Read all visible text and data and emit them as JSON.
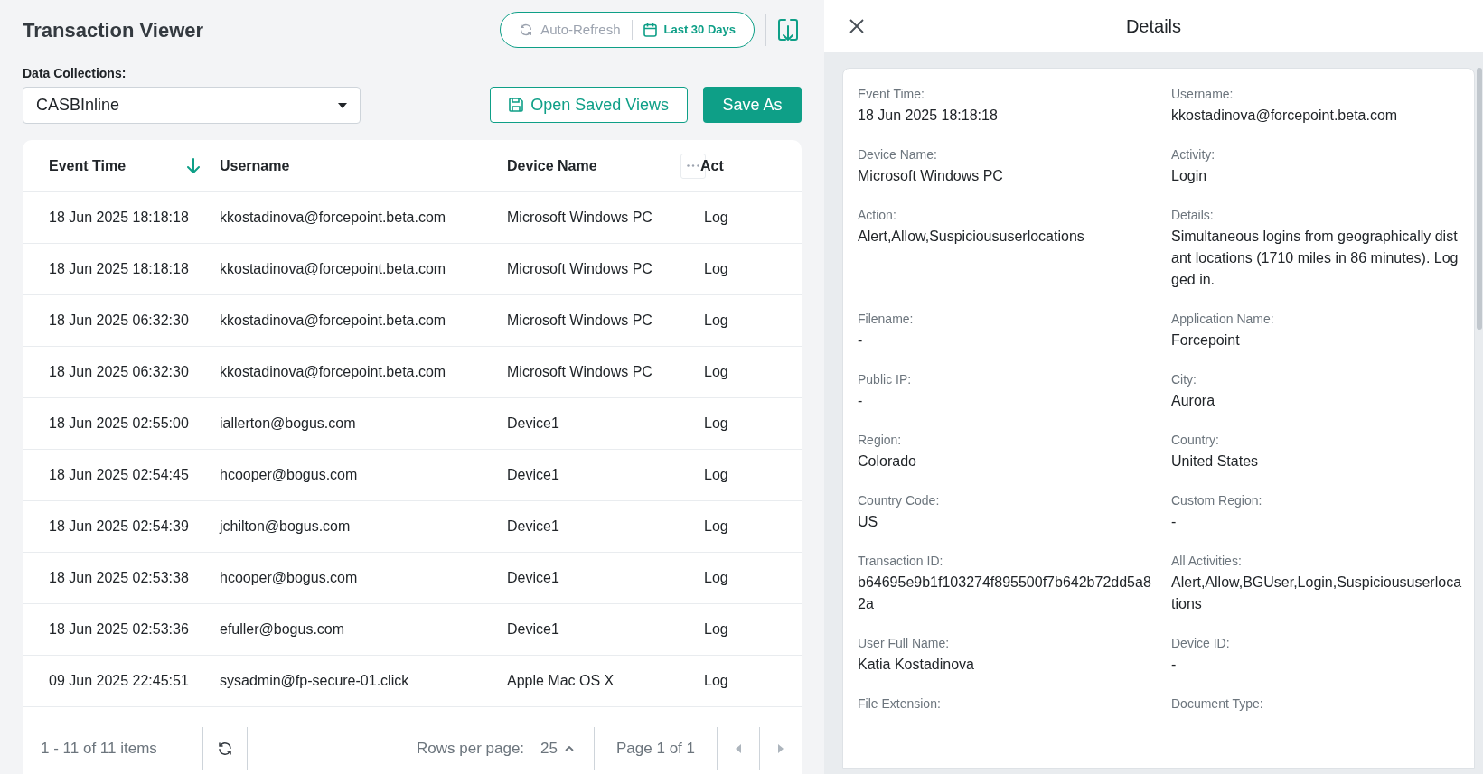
{
  "title": "Transaction Viewer",
  "auto_refresh": {
    "label": "Auto-Refresh",
    "on": false
  },
  "date_range": {
    "label": "Last 30 Days",
    "selected": true
  },
  "collection": {
    "label": "Data Collections:",
    "value": "CASBInline"
  },
  "buttons": {
    "open_saved": "Open Saved Views",
    "save_as": "Save As"
  },
  "table": {
    "columns": [
      {
        "label": "Event Time",
        "sorted": true
      },
      {
        "label": "Username",
        "sorted": false
      },
      {
        "label": "Device Name",
        "sorted": false
      },
      {
        "label": "Act",
        "sorted": false
      }
    ],
    "rows": [
      [
        "18 Jun 2025 18:18:18",
        "kkostadinova@forcepoint.beta.com",
        "Microsoft Windows PC",
        "Log"
      ],
      [
        "18 Jun 2025 18:18:18",
        "kkostadinova@forcepoint.beta.com",
        "Microsoft Windows PC",
        "Log"
      ],
      [
        "18 Jun 2025 06:32:30",
        "kkostadinova@forcepoint.beta.com",
        "Microsoft Windows PC",
        "Log"
      ],
      [
        "18 Jun 2025 06:32:30",
        "kkostadinova@forcepoint.beta.com",
        "Microsoft Windows PC",
        "Log"
      ],
      [
        "18 Jun 2025 02:55:00",
        "iallerton@bogus.com",
        "Device1",
        "Log"
      ],
      [
        "18 Jun 2025 02:54:45",
        "hcooper@bogus.com",
        "Device1",
        "Log"
      ],
      [
        "18 Jun 2025 02:54:39",
        "jchilton@bogus.com",
        "Device1",
        "Log"
      ],
      [
        "18 Jun 2025 02:53:38",
        "hcooper@bogus.com",
        "Device1",
        "Log"
      ],
      [
        "18 Jun 2025 02:53:36",
        "efuller@bogus.com",
        "Device1",
        "Log"
      ],
      [
        "09 Jun 2025 22:45:51",
        "sysadmin@fp-secure-01.click",
        "Apple Mac OS X",
        "Log"
      ]
    ]
  },
  "pagination": {
    "summary": "1 - 11 of 11 items",
    "rows_per_page_label": "Rows per page:",
    "rows_per_page": "25",
    "page": "Page 1 of 1"
  },
  "details": {
    "title": "Details",
    "fields": [
      {
        "label": "Event Time:",
        "value": "18 Jun 2025 18:18:18"
      },
      {
        "label": "Username:",
        "value": "kkostadinova@forcepoint.beta.com"
      },
      {
        "label": "Device Name:",
        "value": "Microsoft Windows PC"
      },
      {
        "label": "Activity:",
        "value": "Login"
      },
      {
        "label": "Action:",
        "value": "Alert,Allow,Suspicioususerlocations"
      },
      {
        "label": "Details:",
        "value": "Simultaneous logins from geographically distant locations (1710 miles in 86 minutes). Logged in."
      },
      {
        "label": "Filename:",
        "value": "-"
      },
      {
        "label": "Application Name:",
        "value": "Forcepoint"
      },
      {
        "label": "Public IP:",
        "value": "-"
      },
      {
        "label": "City:",
        "value": "Aurora"
      },
      {
        "label": "Region:",
        "value": "Colorado"
      },
      {
        "label": "Country:",
        "value": "United States"
      },
      {
        "label": "Country Code:",
        "value": "US"
      },
      {
        "label": "Custom Region:",
        "value": "-"
      },
      {
        "label": "Transaction ID:",
        "value": "b64695e9b1f103274f895500f7b642b72dd5a82a"
      },
      {
        "label": "All Activities:",
        "value": "Alert,Allow,BGUser,Login,Suspicioususerlocations"
      },
      {
        "label": "User Full Name:",
        "value": "Katia Kostadinova"
      },
      {
        "label": "Device ID:",
        "value": "-"
      },
      {
        "label": "File Extension:"
      },
      {
        "label": "Document Type:"
      }
    ]
  }
}
